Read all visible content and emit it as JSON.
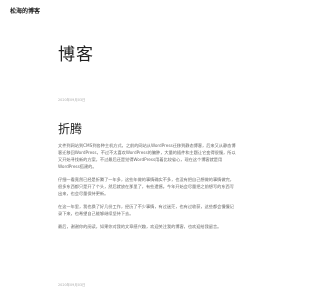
{
  "site": {
    "title": "松海的博客"
  },
  "page": {
    "heading": "博客",
    "date": "2020年09月03日"
  },
  "post": {
    "title": "折腾",
    "paragraphs": [
      "文件到网站到CMS到各种主机方式，之前的网站从WordPress迁移到静态博客，后来又从静态博客迁移回WordPress，不过不太喜欢WordPress的臃肿，大量的插件和主题让它变得很慢，所以又开始寻找新的方案，不过最后还是觉得WordPress用着比较省心，现在这个博客就是用WordPress搭建的。",
      "仔细一看竟然已经是折腾了一年多，这些年做的事情确实不多，也没有把自己想做的事情做完，很多东西都只是开了个头，然后就放在那里了，有些遗憾。今年开始会尽量把之前想写的东西写出来，也会尽量保持更新。",
      "在这一年里，我也换了好几份工作，经历了不少事情，有过迷茫，也有过收获，这些都会慢慢记录下来，也希望自己能够继续坚持下去。",
      "最后，谢谢你的阅读，如果你对我的文章感兴趣，欢迎关注我的博客，也欢迎给我留言。"
    ],
    "date": "2020年09月03日"
  }
}
